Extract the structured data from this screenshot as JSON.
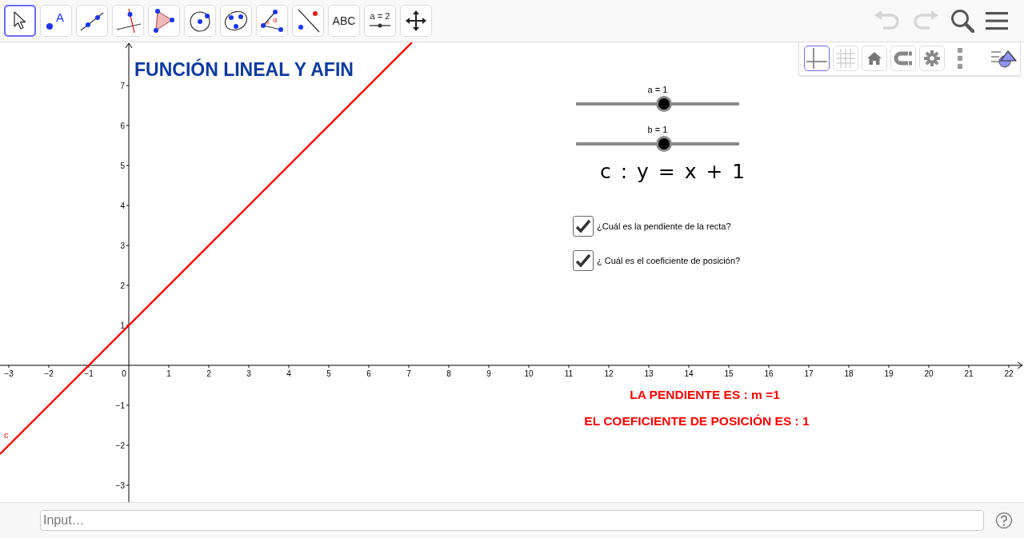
{
  "toolbar": {
    "tools": [
      {
        "kind": "move",
        "selected": true
      },
      {
        "kind": "point",
        "text": "A",
        "selected": false
      },
      {
        "kind": "line",
        "selected": false
      },
      {
        "kind": "perpendicular",
        "selected": false
      },
      {
        "kind": "polygon",
        "selected": false
      },
      {
        "kind": "circle",
        "selected": false
      },
      {
        "kind": "ellipse",
        "selected": false
      },
      {
        "kind": "angle",
        "text": "α",
        "selected": false
      },
      {
        "kind": "reflect",
        "selected": false
      },
      {
        "kind": "text",
        "text": "ABC",
        "selected": false
      },
      {
        "kind": "slider",
        "text": "a = 2",
        "selected": false
      },
      {
        "kind": "move-view",
        "selected": false
      }
    ],
    "actions": [
      {
        "kind": "undo",
        "disabled": true
      },
      {
        "kind": "redo",
        "disabled": true
      },
      {
        "kind": "search",
        "disabled": false
      },
      {
        "kind": "menu",
        "disabled": false
      }
    ]
  },
  "style_bar": {
    "buttons": [
      {
        "kind": "axes",
        "selected": true
      },
      {
        "kind": "grid",
        "selected": false
      },
      {
        "kind": "home",
        "selected": false
      },
      {
        "kind": "magnet",
        "selected": false
      },
      {
        "kind": "settings",
        "selected": false
      },
      {
        "kind": "more"
      },
      {
        "kind": "view-menu"
      }
    ]
  },
  "graphics": {
    "title": "FUNCIÓN LINEAL Y AFIN",
    "chart_data": {
      "type": "line",
      "x": [
        -3.22,
        7.08
      ],
      "xlim": [
        -3.22,
        22.38
      ],
      "ylim": [
        -3.42,
        8.08
      ],
      "series": [
        {
          "name": "c",
          "color": "#ff0000",
          "values": [
            -2.22,
            8.08
          ]
        }
      ],
      "xticks": [
        {
          "value": -3,
          "label": "−3"
        },
        {
          "value": -2,
          "label": "−2"
        },
        {
          "value": -1,
          "label": "−1"
        },
        {
          "value": 0,
          "label": "0"
        },
        1,
        2,
        3,
        4,
        5,
        6,
        7,
        8,
        9,
        10,
        11,
        12,
        13,
        14,
        15,
        16,
        17,
        18,
        19,
        20,
        21,
        22
      ],
      "yticks": [
        {
          "value": -3,
          "label": "−3"
        },
        {
          "value": -2,
          "label": "−2"
        },
        {
          "value": -1,
          "label": "−1"
        },
        1,
        2,
        3,
        4,
        5,
        6,
        7
      ]
    },
    "sliders": [
      {
        "label": "a = 1",
        "level": 0.54
      },
      {
        "label": "b = 1",
        "level": 0.54
      }
    ],
    "equation": "c : y = x + 1",
    "checkboxes": [
      {
        "label": "¿Cuál es la pendiente de la recta?",
        "checked": true
      },
      {
        "label": "¿ Cuál es el coeficiente de posición?",
        "checked": true
      }
    ],
    "results": [
      "LA PENDIENTE ES : m =1",
      "EL COEFICIENTE DE POSICIÓN ES : 1"
    ]
  },
  "input_bar": {
    "placeholder": "Input…"
  }
}
